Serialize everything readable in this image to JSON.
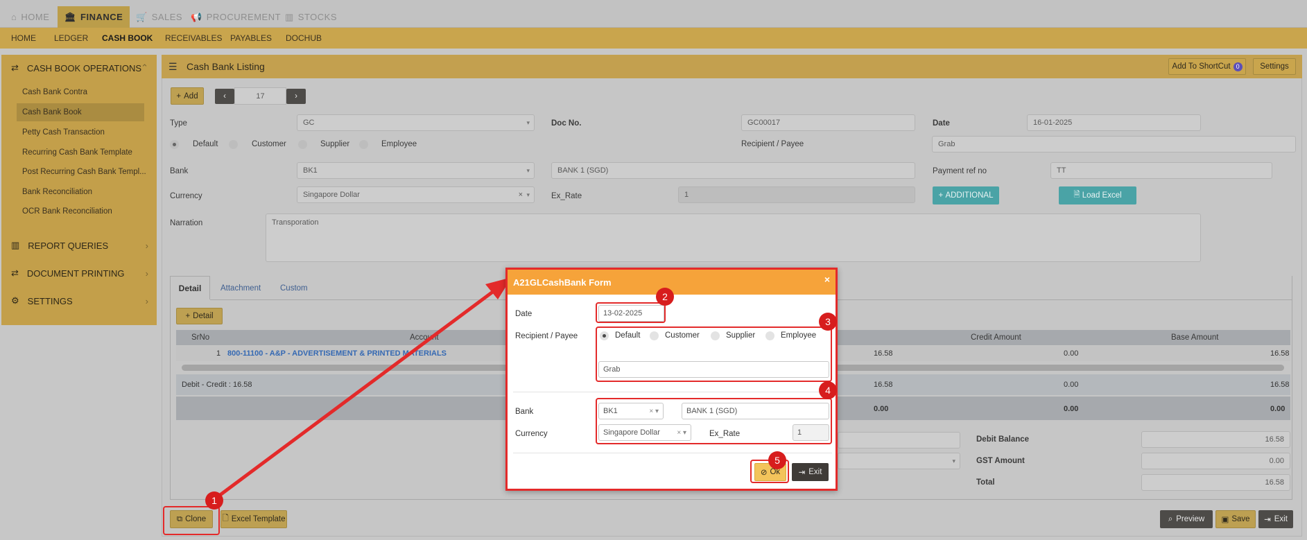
{
  "topnav": {
    "home": "HOME",
    "finance": "FINANCE",
    "sales": "SALES",
    "procurement": "PROCUREMENT",
    "stocks": "STOCKS"
  },
  "subnav": {
    "home": "HOME",
    "ledger": "LEDGER",
    "cashbook": "CASH BOOK",
    "receivables": "RECEIVABLES",
    "payables": "PAYABLES",
    "dochub": "DOCHUB"
  },
  "sidebar": {
    "ops_title": "CASH BOOK OPERATIONS",
    "items": [
      "Cash Bank Contra",
      "Cash Bank Book",
      "Petty Cash Transaction",
      "Recurring Cash Bank Template",
      "Post Recurring Cash Bank Templ...",
      "Bank Reconciliation",
      "OCR Bank Reconciliation"
    ],
    "report": "REPORT QUERIES",
    "printing": "DOCUMENT PRINTING",
    "settings": "SETTINGS"
  },
  "panel": {
    "title": "Cash Bank Listing",
    "shortcut": "Add To ShortCut",
    "shortcut_count": "0",
    "settings": "Settings"
  },
  "toolbar": {
    "add": "Add",
    "record": "17"
  },
  "form": {
    "type_label": "Type",
    "type_value": "GC",
    "docno_label": "Doc No.",
    "docno_value": "GC00017",
    "date_label": "Date",
    "date_value": "16-01-2025",
    "radios": [
      "Default",
      "Customer",
      "Supplier",
      "Employee"
    ],
    "recipient_label": "Recipient / Payee",
    "recipient_value": "Grab",
    "bank_label": "Bank",
    "bank_value": "BK1",
    "bank_name": "BANK 1 (SGD)",
    "payref_label": "Payment ref no",
    "payref_value": "TT",
    "currency_label": "Currency",
    "currency_value": "Singapore Dollar",
    "exrate_label": "Ex_Rate",
    "exrate_value": "1",
    "additional": "ADDITIONAL",
    "load_excel": "Load Excel",
    "narration_label": "Narration",
    "narration_value": "Transporation"
  },
  "tabs": [
    "Detail",
    "Attachment",
    "Custom"
  ],
  "detail": {
    "add_detail": "Detail",
    "columns": {
      "srno": "SrNo",
      "account": "Account",
      "credit": "Credit Amount",
      "base": "Base Amount"
    },
    "row": {
      "srno": "1",
      "account": "800-11100 - A&P - ADVERTISEMENT & PRINTED MATERIALS",
      "debit": "16.58",
      "credit": "0.00",
      "base": "16.58"
    },
    "summary": {
      "label": "Debit - Credit : 16.58",
      "debit": "16.58",
      "credit": "0.00",
      "base": "16.58"
    },
    "totals": {
      "debit": "0.00",
      "credit": "0.00",
      "base": "0.00"
    }
  },
  "balances": {
    "debit_label": "Debit Balance",
    "debit_value": "16.58",
    "gst_label": "GST Amount",
    "gst_value": "0.00",
    "total_label": "Total",
    "total_value": "16.58"
  },
  "bottom": {
    "clone": "Clone",
    "excel": "Excel Template",
    "preview": "Preview",
    "save": "Save",
    "exit": "Exit"
  },
  "modal": {
    "title": "A21GLCashBank Form",
    "close": "×",
    "date_label": "Date",
    "date_value": "13-02-2025",
    "recipient_label": "Recipient / Payee",
    "radios": [
      "Default",
      "Customer",
      "Supplier",
      "Employee"
    ],
    "recipient_value": "Grab",
    "bank_label": "Bank",
    "bank_value": "BK1",
    "bank_name": "BANK 1 (SGD)",
    "currency_label": "Currency",
    "currency_value": "Singapore Dollar",
    "exrate_label": "Ex_Rate",
    "exrate_value": "1",
    "ok": "Ok",
    "exit": "Exit"
  },
  "badges": [
    "1",
    "2",
    "3",
    "4",
    "5"
  ],
  "colors": {
    "accent": "#c9a54d",
    "modal_header": "#f6a33a",
    "annotation": "#e32a2a"
  }
}
